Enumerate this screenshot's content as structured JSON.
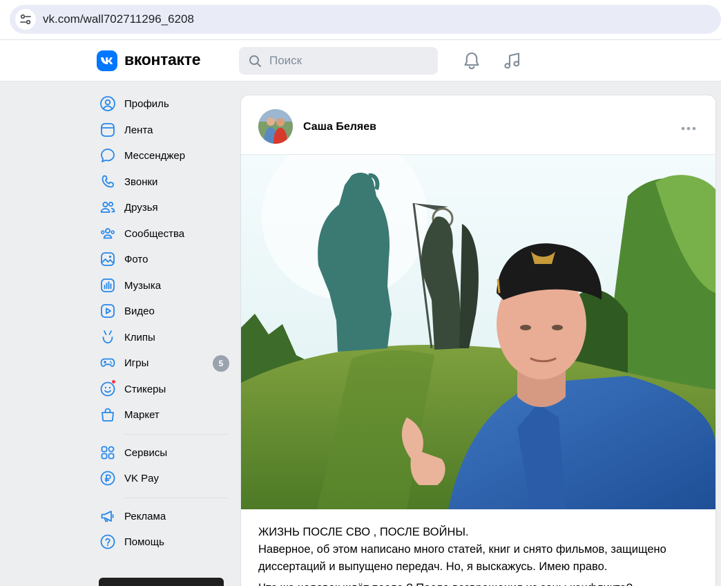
{
  "browser": {
    "url": "vk.com/wall702711296_6208"
  },
  "header": {
    "logo_text": "VK",
    "brand": "вконтакте",
    "search_placeholder": "Поиск",
    "accent_color": "#0077ff"
  },
  "sidebar": {
    "items": [
      {
        "label": "Профиль",
        "icon": "user-circle-icon"
      },
      {
        "label": "Лента",
        "icon": "feed-icon"
      },
      {
        "label": "Мессенджер",
        "icon": "message-icon"
      },
      {
        "label": "Звонки",
        "icon": "phone-icon"
      },
      {
        "label": "Друзья",
        "icon": "friends-icon"
      },
      {
        "label": "Сообщества",
        "icon": "communities-icon"
      },
      {
        "label": "Фото",
        "icon": "photo-icon"
      },
      {
        "label": "Музыка",
        "icon": "music-icon"
      },
      {
        "label": "Видео",
        "icon": "video-icon"
      },
      {
        "label": "Клипы",
        "icon": "clips-icon"
      },
      {
        "label": "Игры",
        "icon": "games-icon",
        "badge": "5"
      },
      {
        "label": "Стикеры",
        "icon": "stickers-icon"
      },
      {
        "label": "Маркет",
        "icon": "market-icon"
      }
    ],
    "services": [
      {
        "label": "Сервисы",
        "icon": "services-icon"
      },
      {
        "label": "VK Pay",
        "icon": "vkpay-icon"
      }
    ],
    "extra": [
      {
        "label": "Реклама",
        "icon": "ads-icon"
      },
      {
        "label": "Помощь",
        "icon": "help-icon"
      }
    ]
  },
  "post": {
    "author": "Саша Беляев",
    "text_title": "ЖИЗНЬ ПОСЛЕ СВО , ПОСЛЕ ВОЙНЫ.",
    "text_body": "Наверное, об этом написано много статей, книг и снято фильмов, защищено диссертаций и выпущено передач. Но, я выскажусь. Имею право.",
    "text_cut": "Что же человек ждёт после ? После возвращения из зоны конфликта?"
  }
}
